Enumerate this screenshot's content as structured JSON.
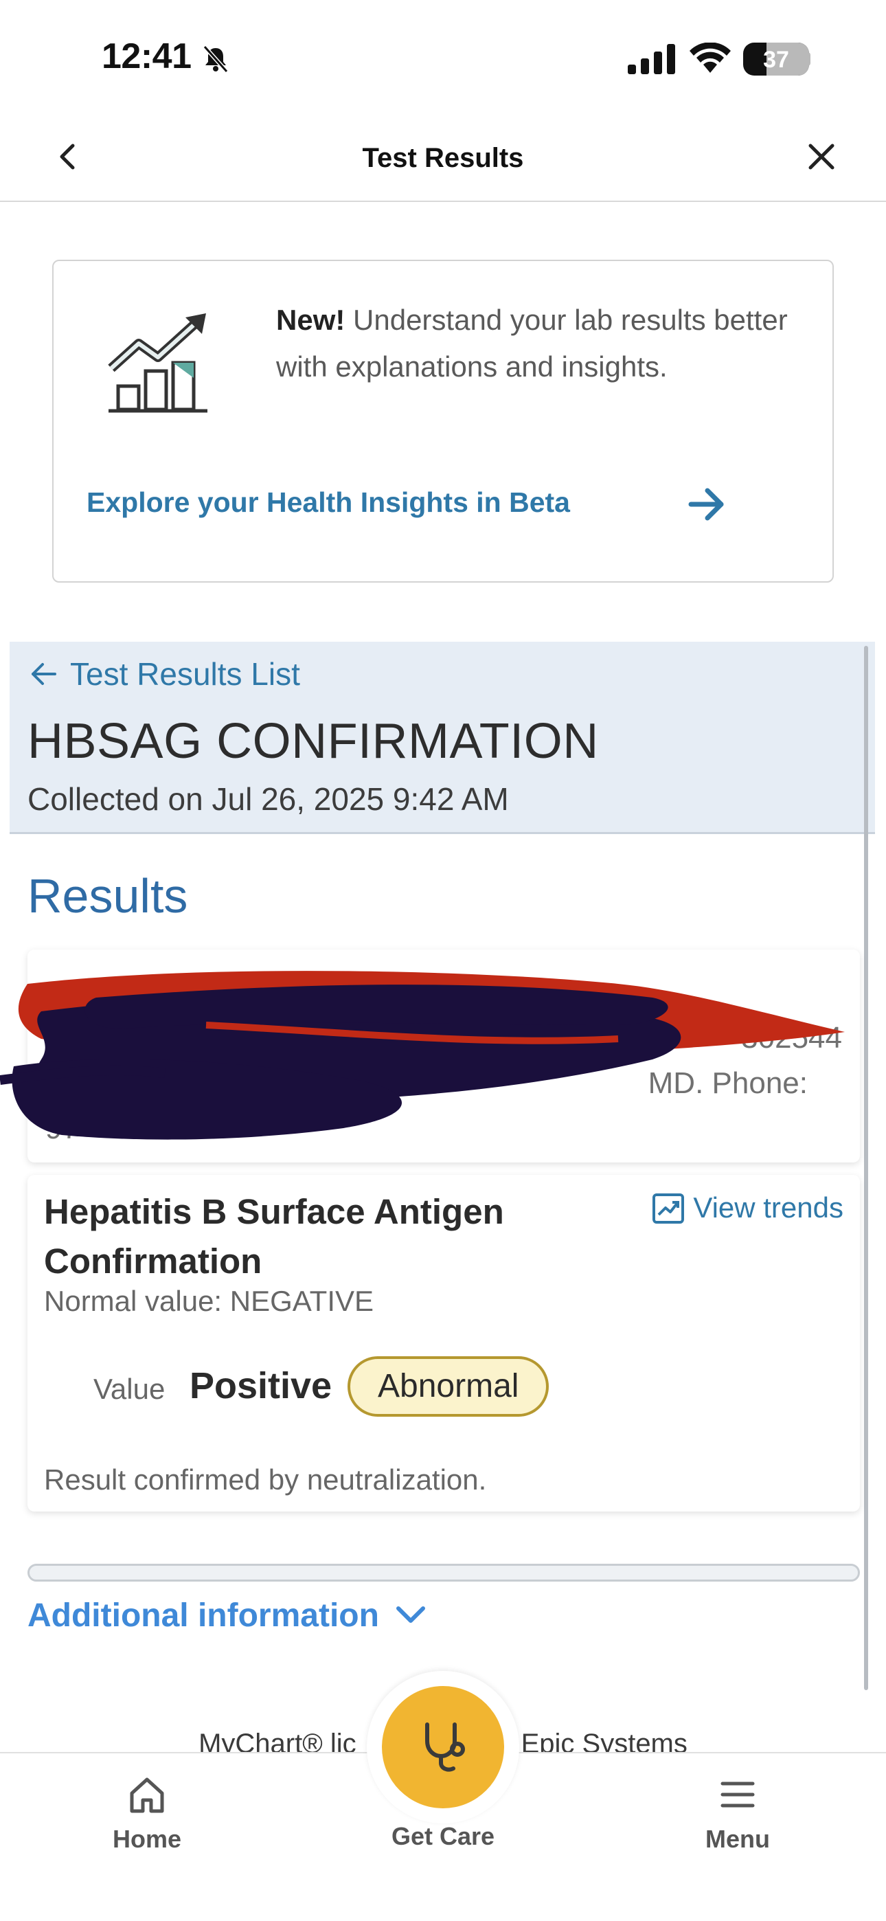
{
  "status_bar": {
    "time": "12:41",
    "battery": "37"
  },
  "nav": {
    "title": "Test Results"
  },
  "insight": {
    "new_label": "New!",
    "text": " Understand your lab results better with explanations and insights.",
    "link": "Explore your Health Insights in Beta"
  },
  "header": {
    "back_link": "Test Results List",
    "title": "HBSAG CONFIRMATION",
    "collected": "Collected on Jul 26, 2025 9:42 AM"
  },
  "results": {
    "heading": "Results",
    "performed_visible_fragments": [
      "302544",
      "MD. Phone:",
      "97"
    ],
    "test_name": "Hepatitis B Surface Antigen Confirmation",
    "trends_label": "View trends",
    "normal_value": "Normal value: NEGATIVE",
    "value_label": "Value",
    "value": "Positive",
    "flag": "Abnormal",
    "comment": "Result confirmed by neutralization."
  },
  "additional_info": {
    "label": "Additional information"
  },
  "footer": {
    "left": "MyChart® lic",
    "right": "Epic Systems"
  },
  "tabs": {
    "home": "Home",
    "get_care": "Get Care",
    "menu": "Menu"
  },
  "colors": {
    "link_blue": "#2f78a8",
    "band_bg": "#e6edf5",
    "flag_bg": "#fbf3cc",
    "flag_border": "#b5982f",
    "care_yellow": "#f1b531"
  }
}
